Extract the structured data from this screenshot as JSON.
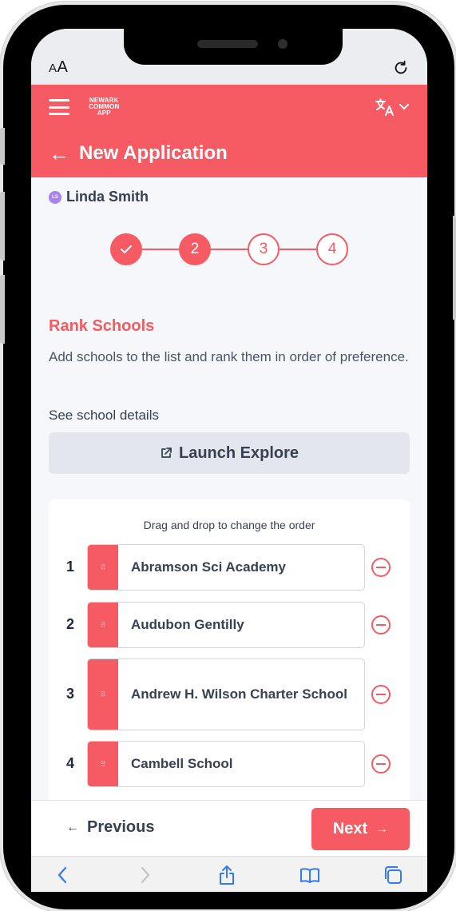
{
  "browser": {
    "text_size_label_small": "A",
    "text_size_label_large": "A"
  },
  "header": {
    "logo_lines": [
      "NEWARK",
      "COMMON",
      "APP"
    ],
    "language_icon": "translate-icon"
  },
  "title_bar": {
    "back_icon": "arrow-left-icon",
    "title": "New Application"
  },
  "user": {
    "initials": "LS",
    "name": "Linda Smith"
  },
  "stepper": {
    "steps": [
      {
        "label": "✓",
        "state": "completed"
      },
      {
        "label": "2",
        "state": "current"
      },
      {
        "label": "3",
        "state": "upcoming"
      },
      {
        "label": "4",
        "state": "upcoming"
      }
    ]
  },
  "section": {
    "title": "Rank Schools",
    "description": "Add schools to the list and rank them in order of preference.",
    "details_label": "See school details",
    "launch_button": "Launch Explore"
  },
  "ranking": {
    "hint": "Drag and drop to change the order",
    "schools": [
      {
        "rank": "1",
        "name": "Abramson Sci Academy"
      },
      {
        "rank": "2",
        "name": "Audubon Gentilly"
      },
      {
        "rank": "3",
        "name": "Andrew H. Wilson Charter School"
      },
      {
        "rank": "4",
        "name": "Cambell School"
      }
    ]
  },
  "footer": {
    "previous_label": "Previous",
    "next_label": "Next"
  },
  "colors": {
    "accent": "#f65a62",
    "background": "#f5f7fa",
    "avatar": "#a784e8"
  }
}
